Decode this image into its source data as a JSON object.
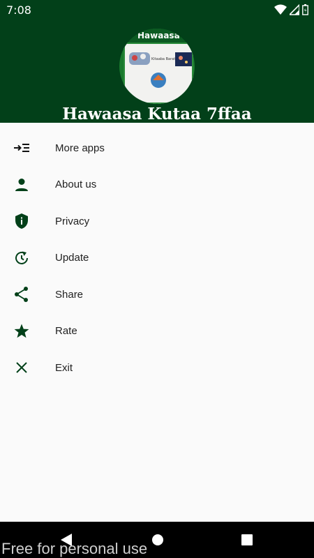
{
  "status_bar": {
    "time": "7:08"
  },
  "header": {
    "title": "Hawaasa Kutaa 7ffaa",
    "logo_title": "Hawaasa",
    "logo_subtitle": "Kitaaba Barattoota"
  },
  "menu": {
    "items": [
      {
        "label": "More apps",
        "icon": "more-apps-icon"
      },
      {
        "label": "About us",
        "icon": "person-icon"
      },
      {
        "label": "Privacy",
        "icon": "shield-info-icon"
      },
      {
        "label": "Update",
        "icon": "update-icon"
      },
      {
        "label": "Share",
        "icon": "share-icon"
      },
      {
        "label": "Rate",
        "icon": "star-icon"
      },
      {
        "label": "Exit",
        "icon": "close-icon"
      }
    ]
  },
  "watermark": "Free for personal use",
  "colors": {
    "header": "#024019",
    "icon": "#024019",
    "background": "#fafafa"
  }
}
